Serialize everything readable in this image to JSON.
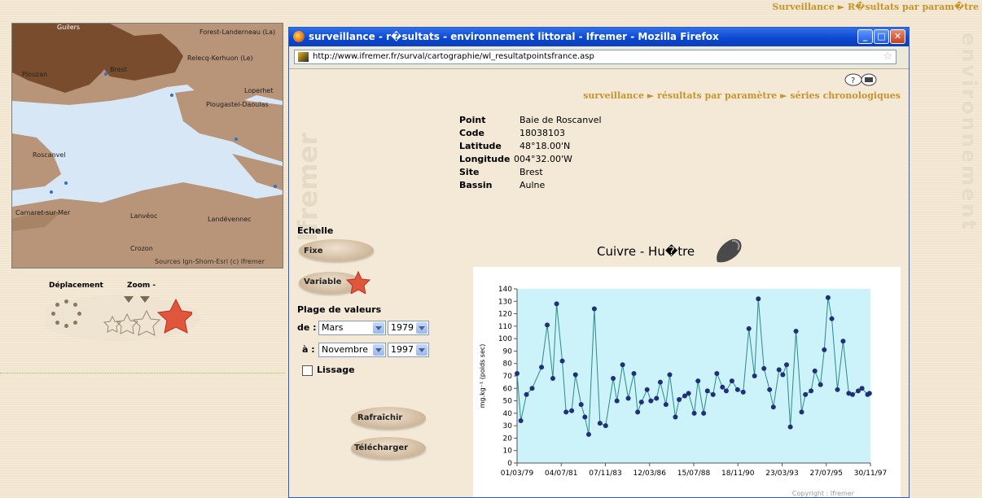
{
  "page": {
    "breadcrumb": "Surveillance ► R�sultats par param�tre",
    "watermark": "environnement"
  },
  "map": {
    "labels": [
      "Guilers",
      "Forest-Landerneau (La)",
      "Relecq-Kerhuon (Le)",
      "Brest",
      "Plouzan",
      "Loperhet",
      "Plougastel-Daoulas",
      "Roscanvel",
      "Camaret-sur-Mer",
      "Lanvéoc",
      "Landévennec",
      "Crozon",
      "Sources Ign-Shom-Esri  (c) Ifremer"
    ]
  },
  "nav": {
    "move_label": "Déplacement",
    "zoom_label": "Zoom -"
  },
  "window": {
    "title": "surveillance - r�sultats - environnement littoral - Ifremer - Mozilla Firefox",
    "url": "http://www.ifremer.fr/surval/cartographie/wl_resultatpointsfrance.asp",
    "breadcrumb": "surveillance ► résultats par paramètre ► séries chronologiques",
    "info": {
      "point_label": "Point",
      "point": "Baie de Roscanvel",
      "code_label": "Code",
      "code": "18038103",
      "lat_label": "Latitude",
      "lat": "48°18.00'N",
      "lon_label": "Longitude",
      "lon": "004°32.00'W",
      "site_label": "Site",
      "site": "Brest",
      "bassin_label": "Bassin",
      "bassin": "Aulne"
    },
    "controls": {
      "echelle": "Echelle",
      "fixe": "Fixe",
      "variable": "Variable",
      "plage": "Plage de valeurs",
      "de_label": "de :",
      "de_month": "Mars",
      "de_year": "1979",
      "a_label": "à :",
      "a_month": "Novembre",
      "a_year": "1997",
      "lissage": "Lissage",
      "rafraichir": "Rafraîchir",
      "telecharger": "Télécharger"
    }
  },
  "chart_data": {
    "type": "line",
    "title": "Cuivre - Hu�tre",
    "ylabel": "mg.kg⁻¹ (poids sec)",
    "ylim": [
      0,
      140
    ],
    "yticks": [
      0,
      10,
      20,
      30,
      40,
      50,
      60,
      70,
      80,
      90,
      100,
      110,
      120,
      130,
      140
    ],
    "xticks": [
      "01/03/79",
      "04/07/81",
      "07/11/83",
      "12/03/86",
      "15/07/88",
      "18/11/90",
      "23/03/93",
      "27/07/95",
      "30/11/97"
    ],
    "copyright": "Copyright : Ifremer",
    "grid": false,
    "background": "#ccf2fa",
    "line_color": "#2b8a8a",
    "marker_color": "#1f2f78",
    "series": [
      {
        "x": [
          0.0,
          0.2,
          0.5,
          0.8,
          1.3,
          1.6,
          1.9,
          2.1,
          2.4,
          2.6,
          2.9,
          3.1,
          3.4,
          3.6,
          3.8,
          4.1,
          4.4,
          4.7,
          5.1,
          5.3,
          5.6,
          5.9,
          6.2,
          6.4,
          6.6,
          6.9,
          7.1,
          7.4,
          7.6,
          7.9,
          8.1,
          8.4,
          8.6,
          8.9,
          9.1,
          9.4,
          9.6,
          9.9,
          10.1,
          10.4,
          10.6,
          10.9,
          11.1,
          11.4,
          11.7,
          12.0,
          12.3,
          12.6,
          12.8,
          13.1,
          13.4,
          13.6,
          13.9,
          14.1,
          14.3,
          14.5,
          14.8,
          15.1,
          15.3,
          15.6,
          15.8,
          16.1,
          16.3,
          16.5,
          16.7,
          17.0,
          17.3,
          17.6,
          17.8,
          18.1,
          18.3,
          18.6,
          18.7
        ],
        "y": [
          72,
          34,
          55,
          60,
          77,
          111,
          68,
          128,
          82,
          41,
          42,
          71,
          47,
          37,
          23,
          124,
          32,
          30,
          68,
          50,
          79,
          52,
          72,
          41,
          49,
          59,
          50,
          52,
          65,
          47,
          71,
          37,
          51,
          54,
          56,
          40,
          66,
          40,
          58,
          55,
          72,
          61,
          58,
          66,
          59,
          57,
          108,
          70,
          132,
          76,
          59,
          45,
          75,
          71,
          79,
          29,
          106,
          41,
          55,
          58,
          74,
          63,
          91,
          133,
          116,
          59,
          98,
          56,
          55,
          58,
          60,
          55,
          56
        ]
      }
    ]
  }
}
